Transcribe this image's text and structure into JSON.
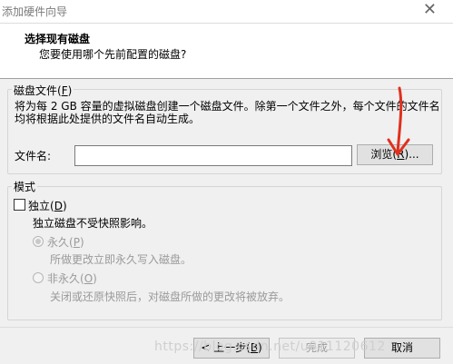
{
  "window": {
    "title": "添加硬件向导"
  },
  "header": {
    "title": "选择现有磁盘",
    "subtitle": "您要使用哪个先前配置的磁盘?"
  },
  "disk_file_group": {
    "legend_prefix": "磁盘文件(",
    "legend_key": "F",
    "legend_suffix": ")",
    "description": "将为每 2 GB 容量的虚拟磁盘创建一个磁盘文件。除第一个文件之外，每个文件的文件名均将根据此处提供的文件名自动生成。",
    "filename_label": "文件名:",
    "filename_value": "",
    "browse_prefix": "浏览(",
    "browse_key": "R",
    "browse_suffix": ")..."
  },
  "mode_group": {
    "legend": "模式",
    "independent": {
      "prefix": "独立(",
      "key": "D",
      "suffix": ")",
      "checked": false,
      "hint": "独立磁盘不受快照影响。"
    },
    "persistent": {
      "prefix": "永久(",
      "key": "P",
      "suffix": ")",
      "selected": true,
      "hint": "所做更改立即永久写入磁盘。"
    },
    "nonpersistent": {
      "prefix": "非永久(",
      "key": "O",
      "suffix": ")",
      "selected": false,
      "hint": "关闭或还原快照后，对磁盘所做的更改将被放弃。"
    }
  },
  "footer": {
    "back_prefix": "< 上一步(",
    "back_key": "B",
    "back_suffix": ")",
    "finish": "完成",
    "cancel": "取消",
    "watermark": "https://blog.csdn.net/u011120612"
  },
  "colors": {
    "annotation_arrow": "#e0301e",
    "dialog_bg": "#f0f0f0"
  },
  "icons": {
    "close": "close-icon",
    "annotation": "red-arrow-icon"
  }
}
